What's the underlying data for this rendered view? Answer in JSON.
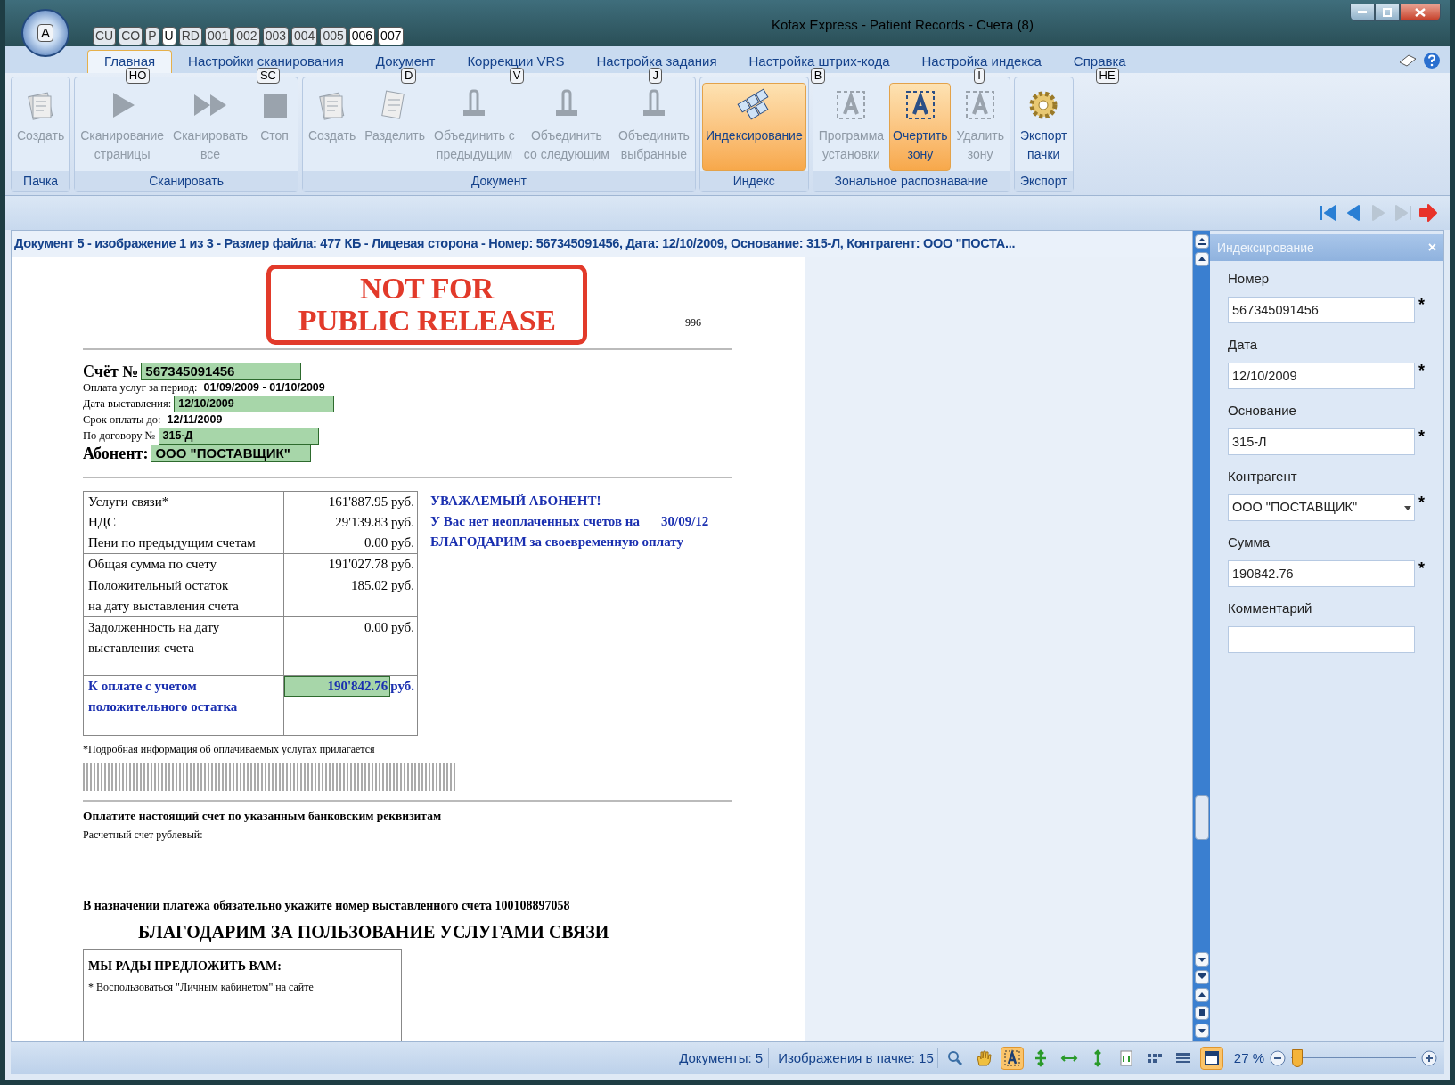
{
  "window": {
    "title": "Kofax Express - Patient Records - Счета (8)",
    "orb_keytip": "A"
  },
  "qat_keytips": [
    {
      "label": "CU",
      "active": false
    },
    {
      "label": "CO",
      "active": false
    },
    {
      "label": "P",
      "active": false
    },
    {
      "label": "U",
      "active": true
    },
    {
      "label": "RD",
      "active": false
    },
    {
      "label": "001",
      "active": false
    },
    {
      "label": "002",
      "active": false
    },
    {
      "label": "003",
      "active": false
    },
    {
      "label": "004",
      "active": false
    },
    {
      "label": "005",
      "active": false
    },
    {
      "label": "006",
      "active": true
    },
    {
      "label": "007",
      "active": true
    }
  ],
  "tabs": [
    {
      "label": "Главная",
      "keytip": "HO",
      "selected": true
    },
    {
      "label": "Настройки сканирования",
      "keytip": "SC",
      "selected": false
    },
    {
      "label": "Документ",
      "keytip": "D",
      "selected": false
    },
    {
      "label": "Коррекции VRS",
      "keytip": "V",
      "selected": false
    },
    {
      "label": "Настройка задания",
      "keytip": "J",
      "selected": false
    },
    {
      "label": "Настройка штрих-кода",
      "keytip": "B",
      "selected": false
    },
    {
      "label": "Настройка индекса",
      "keytip": "I",
      "selected": false
    },
    {
      "label": "Справка",
      "keytip": "HE",
      "selected": false
    }
  ],
  "ribbon_groups": [
    {
      "title": "Пачка",
      "buttons": [
        {
          "label": "Создать",
          "disabled": true,
          "active": false
        }
      ]
    },
    {
      "title": "Сканировать",
      "buttons": [
        {
          "label": "Сканирование\nстраницы",
          "disabled": true,
          "active": false
        },
        {
          "label": "Сканировать\nвсе",
          "disabled": true,
          "active": false
        },
        {
          "label": "Стоп",
          "disabled": true,
          "active": false
        }
      ]
    },
    {
      "title": "Документ",
      "buttons": [
        {
          "label": "Создать",
          "disabled": true,
          "active": false
        },
        {
          "label": "Разделить",
          "disabled": true,
          "active": false
        },
        {
          "label": "Объединить с\nпредыдущим",
          "disabled": true,
          "active": false
        },
        {
          "label": "Объединить\nсо следующим",
          "disabled": true,
          "active": false
        },
        {
          "label": "Объединить\nвыбранные",
          "disabled": true,
          "active": false
        }
      ]
    },
    {
      "title": "Индекс",
      "buttons": [
        {
          "label": "Индексирование",
          "disabled": false,
          "active": true
        }
      ]
    },
    {
      "title": "Зональное распознавание",
      "buttons": [
        {
          "label": "Программа\nустановки",
          "disabled": true,
          "active": false
        },
        {
          "label": "Очертить\nзону",
          "disabled": false,
          "active": true
        },
        {
          "label": "Удалить\nзону",
          "disabled": true,
          "active": false
        }
      ]
    },
    {
      "title": "Экспорт",
      "buttons": [
        {
          "label": "Экспорт\nпачки",
          "disabled": false,
          "active": false
        }
      ]
    }
  ],
  "document_header": "Документ 5 - изображение 1 из 3 - Размер файла: 477 КБ - Лицевая сторона  - Номер: 567345091456, Дата: 12/10/2009, Основание: 315-Л, Контрагент: ООО \"ПОСТА...",
  "document": {
    "stamp": [
      "NOT FOR",
      "PUBLIC RELEASE"
    ],
    "page_number": "996",
    "invoice_lines": [
      {
        "label": "Счёт №",
        "value": "567345091456",
        "zone": true,
        "kind": "large"
      },
      {
        "label": "Оплата услуг за период:",
        "value": "01/09/2009 - 01/10/2009",
        "zone": false,
        "kind": "small"
      },
      {
        "label": "Дата выставления:",
        "value": "12/10/2009",
        "zone": true,
        "kind": "small"
      },
      {
        "label": "Срок оплаты до:",
        "value": "12/11/2009",
        "zone": false,
        "kind": "small"
      },
      {
        "label": "По договору №",
        "value": "315-Д",
        "zone": true,
        "kind": "small"
      },
      {
        "label": "Абонент:",
        "value": "ООО \"ПОСТАВЩИК\"",
        "zone": true,
        "kind": "large"
      }
    ],
    "charges": [
      {
        "kind": "normal",
        "items": [
          {
            "label": "Услуги связи*",
            "amount": "161'887.95 руб."
          },
          {
            "label": "НДС",
            "amount": "29'139.83 руб."
          },
          {
            "label": "Пени по предыдущим счетам",
            "amount": "0.00 руб."
          }
        ]
      },
      {
        "kind": "normal",
        "items": [
          {
            "label": "Общая сумма по счету",
            "amount": "191'027.78 руб."
          }
        ]
      },
      {
        "kind": "normal",
        "items": [
          {
            "label": "Положительный остаток\nна дату выставления счета",
            "amount": "185.02 руб."
          }
        ]
      },
      {
        "kind": "tall",
        "items": [
          {
            "label": "Задолженность на дату\nвыставления счета",
            "amount": "0.00 руб."
          }
        ]
      },
      {
        "kind": "total",
        "items": [
          {
            "label": "К оплате с учетом\nположительного остатка",
            "amount": "190'842.76",
            "unit": "руб."
          }
        ]
      }
    ],
    "message": [
      {
        "text": "УВАЖАЕМЫЙ АБОНЕНТ!"
      },
      {
        "text": "У Вас нет неоплаченных счетов на",
        "date": "30/09/12"
      },
      {
        "text": "БЛАГОДАРИМ за своевременную оплату"
      }
    ],
    "footnote": "*Подробная информация об оплачиваемых услугах прилагается",
    "payment_heading": "Оплатите настоящий счет по указанным банковским реквизитам",
    "account_label": "Расчетный счет рублевый:",
    "purpose_line": "В назначении платежа обязательно укажите номер выставленного счета  100108897058",
    "thanks_heading": "БЛАГОДАРИМ ЗА ПОЛЬЗОВАНИЕ УСЛУГАМИ СВЯЗИ",
    "offer_box": {
      "title": "МЫ РАДЫ ПРЕДЛОЖИТЬ ВАМ:",
      "bullet": "* Воспользоваться \"Личным кабинетом\" на сайте"
    }
  },
  "index_panel": {
    "title": "Индексирование",
    "close": "×",
    "fields": [
      {
        "label": "Номер",
        "value": "567345091456",
        "mark": "*",
        "kind": "text"
      },
      {
        "label": "Дата",
        "value": "12/10/2009",
        "mark": "*",
        "kind": "text"
      },
      {
        "label": "Основание",
        "value": "315-Л",
        "mark": "*",
        "kind": "text"
      },
      {
        "label": "Контрагент",
        "value": "ООО \"ПОСТАВЩИК\"",
        "mark": "*",
        "kind": "dropdown"
      },
      {
        "label": "Сумма",
        "value": "190842.76",
        "mark": "*",
        "kind": "text"
      },
      {
        "label": "Комментарий",
        "kind": "text"
      }
    ]
  },
  "status_bar": {
    "documents": "Документы: 5",
    "images": "Изображения в пачке: 15",
    "tools": [
      {
        "active": false
      },
      {
        "active": false
      },
      {
        "active": true
      },
      {
        "active": false
      },
      {
        "active": false
      },
      {
        "active": false
      },
      {
        "active": false
      },
      {
        "active": false
      },
      {
        "active": false
      },
      {
        "active": true
      }
    ],
    "zoom": "27 %",
    "zoom_slider": {
      "level": 0.05
    }
  }
}
